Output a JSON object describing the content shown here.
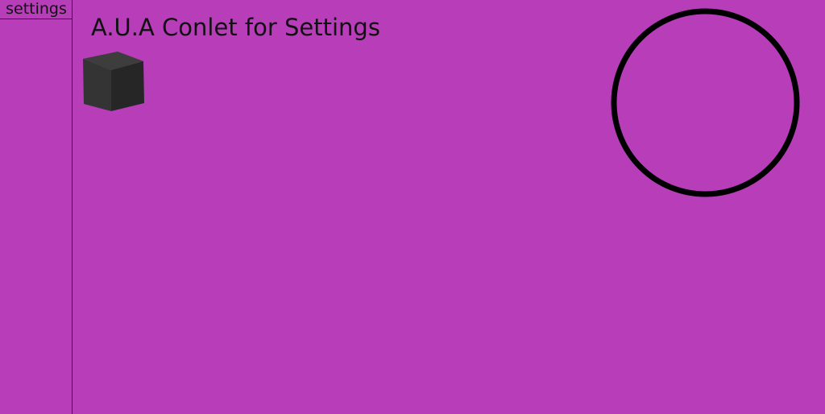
{
  "sidebar": {
    "items": [
      {
        "label": "settings"
      }
    ]
  },
  "main": {
    "title": "A.U.A Conlet for Settings"
  },
  "colors": {
    "background": "#b73db9",
    "cube_top": "#3d3d3d",
    "cube_left": "#343434",
    "cube_right": "#262626",
    "circle_stroke": "#000000"
  },
  "icons": {
    "cube": "cube-icon",
    "circle": "circle-shape"
  }
}
